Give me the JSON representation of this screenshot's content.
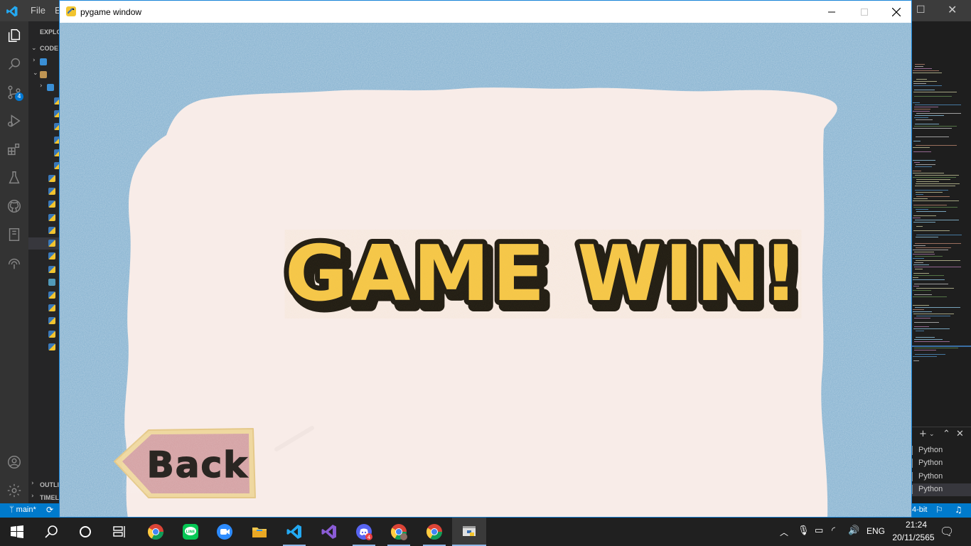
{
  "vscode": {
    "menu": [
      "File",
      "E"
    ],
    "sidebar": {
      "explorer_label": "EXPLO",
      "folder_label": "CODE",
      "outline_label": "OUTLI",
      "timeline_label": "TIMEL"
    },
    "source_control_badge": "4",
    "status": {
      "branch": "main*",
      "bitness": "4-bit"
    },
    "terminal_items": [
      "Python",
      "Python",
      "Python",
      "Python"
    ]
  },
  "pygame_window": {
    "title": "pygame window",
    "heading": "GAME WIN!",
    "back_button_label": "Back"
  },
  "taskbar": {
    "discord_badge": "4",
    "language": "ENG",
    "time": "21:24",
    "date": "20/11/2565"
  },
  "colors": {
    "border_blue": "#8eb7d3",
    "paper": "#f8ece8",
    "title_fill": "#f6c84a",
    "title_outline": "#1d1a14",
    "back_fill": "#d5a3a5",
    "back_border": "#efd8a0",
    "vscode_status": "#007acc"
  }
}
